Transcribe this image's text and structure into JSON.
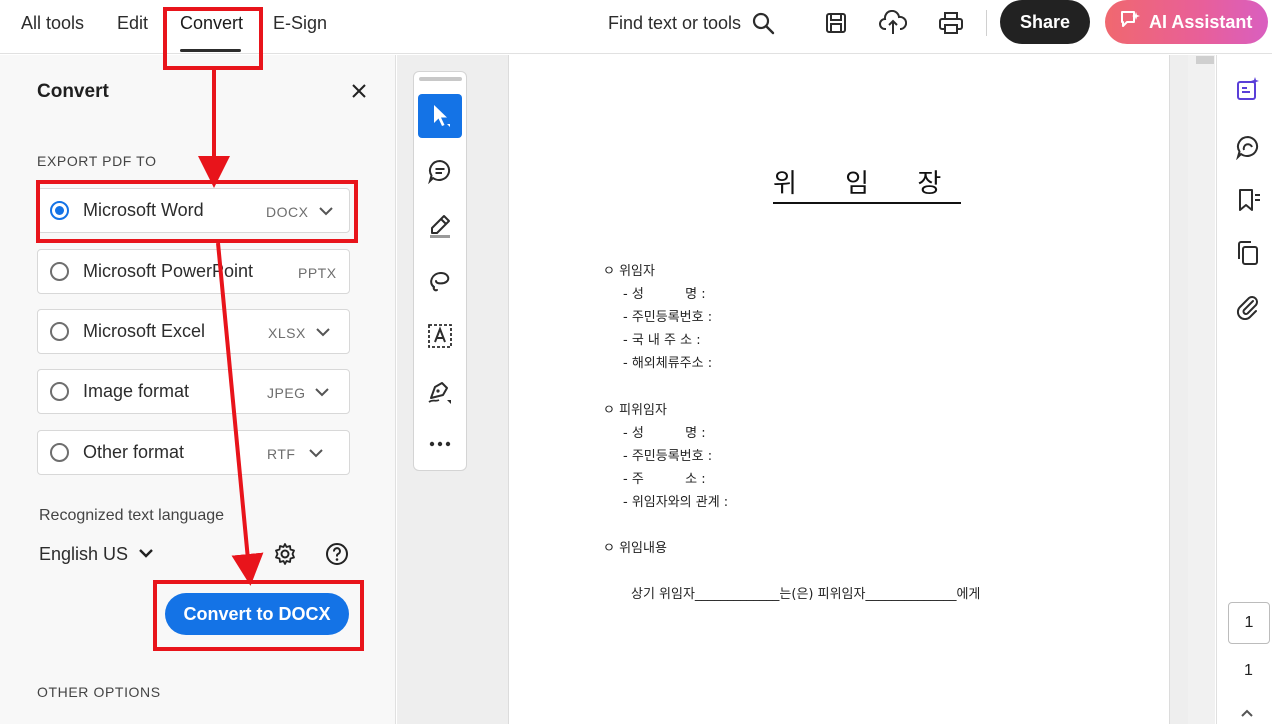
{
  "topnav": {
    "tabs": [
      "All tools",
      "Edit",
      "Convert",
      "E-Sign"
    ],
    "active_tab": "Convert",
    "find_text": "Find text or tools",
    "share_label": "Share",
    "ai_label": "AI Assistant"
  },
  "panel": {
    "title": "Convert",
    "section_export": "EXPORT PDF TO",
    "options": [
      {
        "label": "Microsoft Word",
        "ext": "DOCX",
        "selected": true
      },
      {
        "label": "Microsoft PowerPoint",
        "ext": "PPTX",
        "selected": false
      },
      {
        "label": "Microsoft Excel",
        "ext": "XLSX",
        "selected": false
      },
      {
        "label": "Image format",
        "ext": "JPEG",
        "selected": false
      },
      {
        "label": "Other format",
        "ext": "RTF",
        "selected": false
      }
    ],
    "lang_label": "Recognized text language",
    "lang_value": "English US",
    "convert_label": "Convert to DOCX",
    "section_other": "OTHER OPTIONS"
  },
  "document": {
    "title": "위 임 장",
    "lines": [
      "ㅇ 위임자",
      "- 성          명 :",
      "- 주민등록번호 :",
      "- 국 내 주 소 :",
      "- 해외체류주소 :",
      "ㅇ 피위임자",
      "- 성          명 :",
      "- 주민등록번호 :",
      "- 주          소 :",
      "- 위임자와의 관계 :",
      "ㅇ 위임내용",
      "상기 위임자_____________는(은) 피위임자______________에게"
    ]
  },
  "pager": {
    "current": "1",
    "total": "1"
  },
  "colors": {
    "accent": "#1473e6",
    "annotation": "#e8141b",
    "share_bg": "#222222",
    "ai_gradient_start": "#f0686f",
    "ai_gradient_end": "#d95fc0"
  },
  "icons": {
    "toolbar": [
      "search-icon",
      "save-icon",
      "cloud-upload-icon",
      "print-icon"
    ],
    "vertical_tools": [
      "select-arrow-icon",
      "comment-icon",
      "highlight-pen-icon",
      "lasso-draw-icon",
      "text-box-icon",
      "signature-pen-icon",
      "more-icon"
    ],
    "rail": [
      "ai-sparkle-icon",
      "comments-panel-icon",
      "bookmark-icon",
      "copy-pages-icon",
      "attachment-icon"
    ]
  }
}
